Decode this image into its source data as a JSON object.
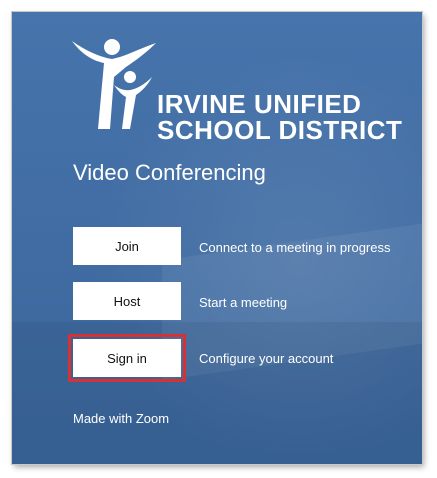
{
  "logo": {
    "line1": "IRVINE UNIFIED",
    "line2": "SCHOOL DISTRICT",
    "icon": "figures-logo-icon"
  },
  "page_title": "Video Conferencing",
  "actions": {
    "join": {
      "label": "Join",
      "description": "Connect to a meeting in progress"
    },
    "host": {
      "label": "Host",
      "description": "Start a meeting"
    },
    "signin": {
      "label": "Sign in",
      "description": "Configure your account"
    }
  },
  "footer": {
    "made_with": "Made with Zoom"
  },
  "colors": {
    "background": "#3f6ea8",
    "button": "#ffffff",
    "highlight": "#d63232"
  }
}
